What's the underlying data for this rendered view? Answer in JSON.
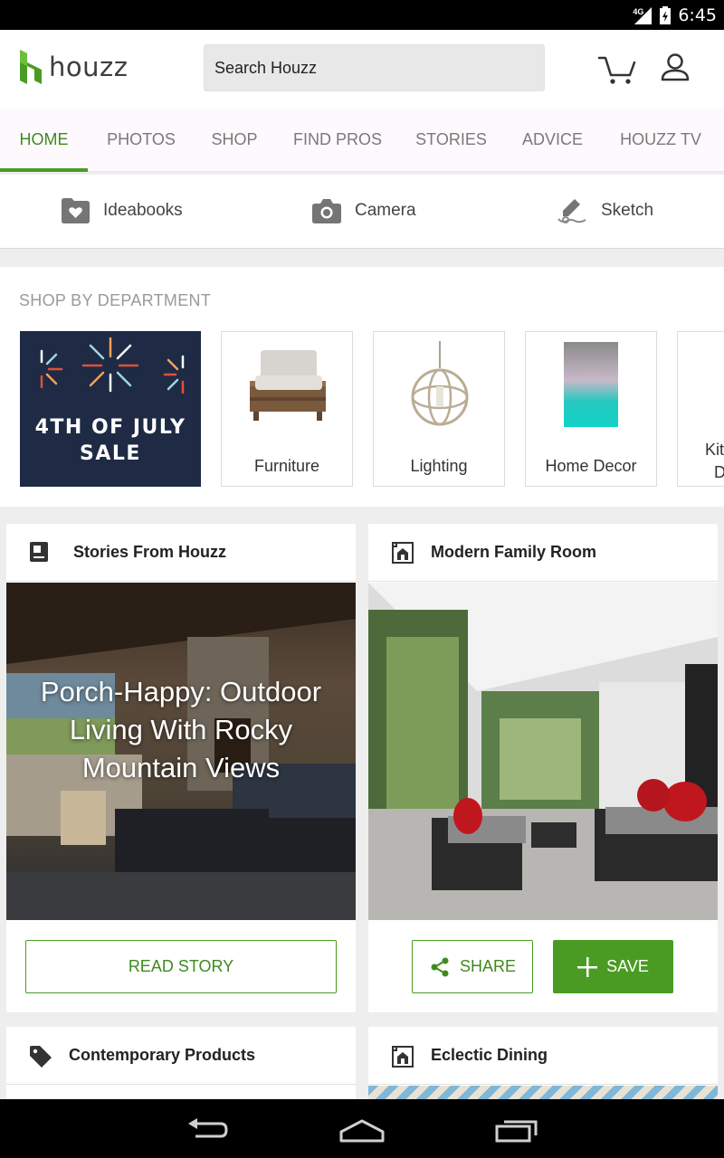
{
  "status_bar": {
    "time": "6:45",
    "network": "4G"
  },
  "app": {
    "logo_text": "houzz",
    "brand_color": "#4a9b23"
  },
  "search": {
    "placeholder": "Search Houzz"
  },
  "tabs": [
    {
      "label": "HOME",
      "active": true
    },
    {
      "label": "PHOTOS"
    },
    {
      "label": "SHOP"
    },
    {
      "label": "FIND PROS"
    },
    {
      "label": "STORIES"
    },
    {
      "label": "ADVICE"
    },
    {
      "label": "HOUZZ TV"
    }
  ],
  "quick_actions": [
    {
      "label": "Ideabooks",
      "icon": "ideabook-heart-icon"
    },
    {
      "label": "Camera",
      "icon": "camera-icon"
    },
    {
      "label": "Sketch",
      "icon": "sketch-pen-icon"
    }
  ],
  "shop": {
    "title": "SHOP BY DEPARTMENT",
    "sale_banner": "4TH OF JULY SALE",
    "sale_line1": "4TH OF JULY",
    "sale_line2": "SALE",
    "departments": [
      "Furniture",
      "Lighting",
      "Home Decor",
      "Kitchen & Dining"
    ],
    "partial_department_visible": "Kit D"
  },
  "feed": {
    "stories": {
      "title": "Stories From Houzz",
      "headline": "Porch-Happy: Outdoor Living With Rocky Mountain Views",
      "button": "READ STORY"
    },
    "room": {
      "title": "Modern Family Room",
      "share": "SHARE",
      "save": "SAVE"
    },
    "products": {
      "title": "Contemporary Products"
    },
    "dining": {
      "title": "Eclectic Dining"
    }
  }
}
